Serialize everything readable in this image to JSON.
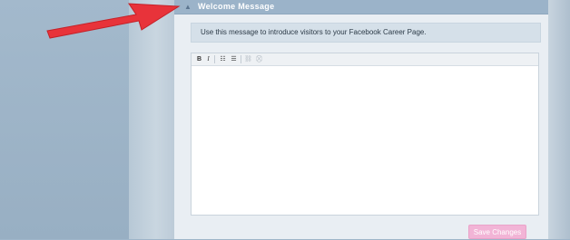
{
  "section": {
    "title": "Welcome Message",
    "toggle_icon": "triangle-expand-icon"
  },
  "intro_message": "Use this message to introduce visitors to your Facebook Career Page.",
  "editor": {
    "toolbar": {
      "bold": "B",
      "italic": "I",
      "bullet_list": "☷",
      "numbered_list": "☰",
      "link": "⛓",
      "unlink": "⛒"
    },
    "content": ""
  },
  "actions": {
    "save_label": "Save Changes"
  },
  "colors": {
    "header": "#9bb3c9",
    "save_button": "#f2b4d6",
    "annotation_arrow": "#e8333a"
  }
}
